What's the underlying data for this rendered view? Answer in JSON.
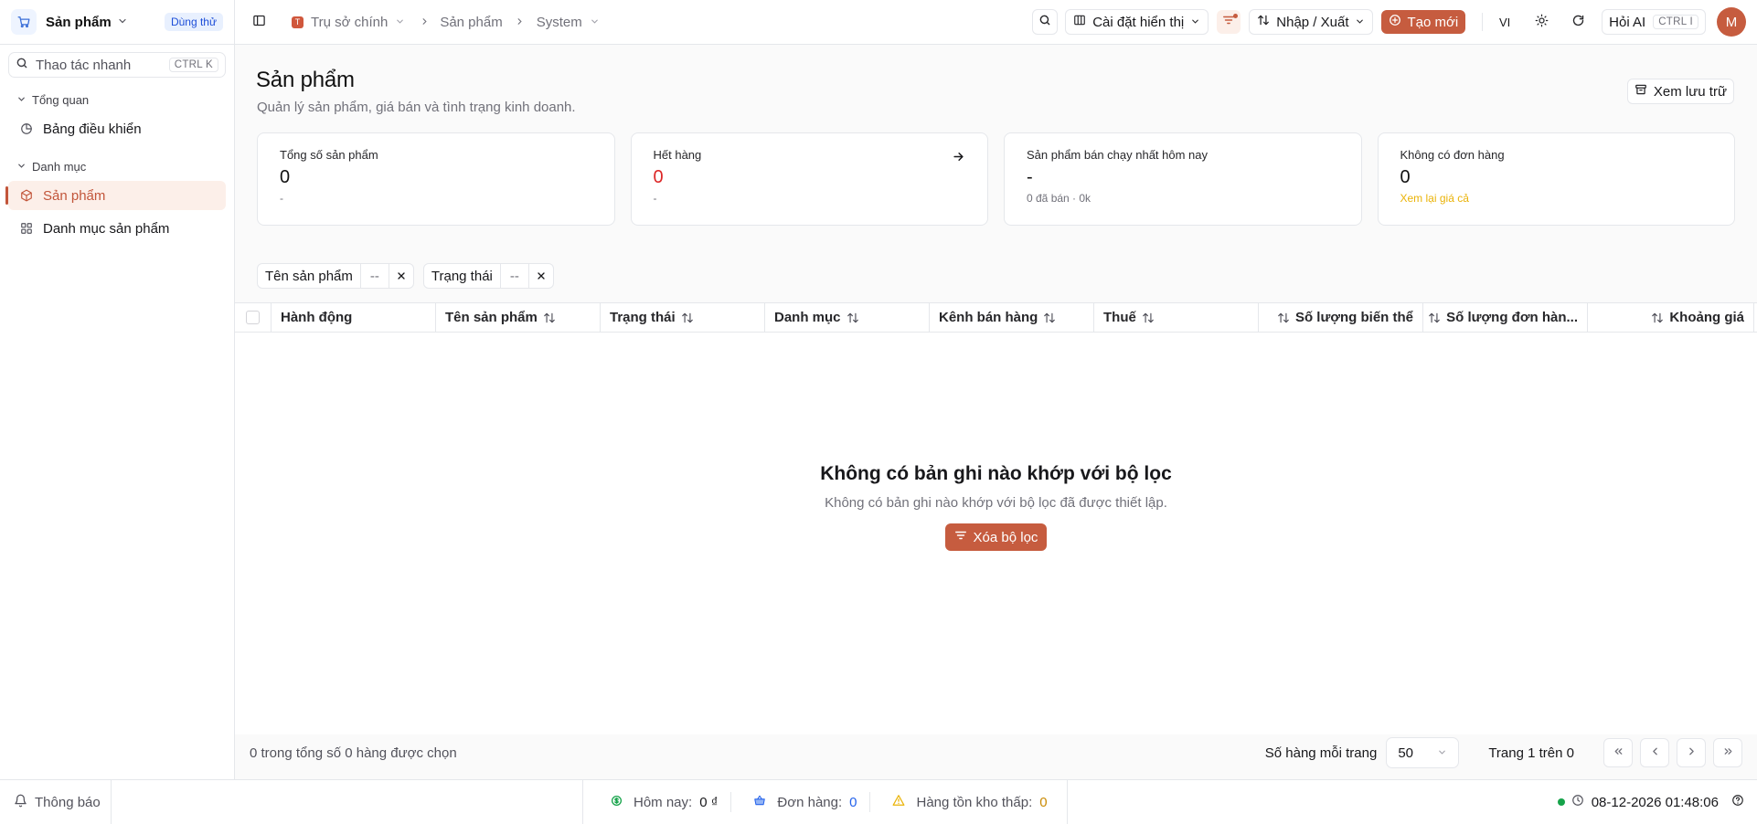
{
  "app": {
    "name": "Sản phẩm",
    "trial_badge": "Dùng thử"
  },
  "quick_search": {
    "placeholder": "Thao tác nhanh",
    "shortcut": "CTRL K"
  },
  "sidebar": {
    "groups": [
      {
        "title": "Tổng quan",
        "items": [
          {
            "label": "Bảng điều khiển",
            "icon": "dashboard-icon"
          }
        ]
      },
      {
        "title": "Danh mục",
        "items": [
          {
            "label": "Sản phẩm",
            "icon": "box-icon",
            "active": true
          },
          {
            "label": "Danh mục sản phẩm",
            "icon": "grid-icon"
          }
        ]
      }
    ]
  },
  "topbar": {
    "breadcrumb": {
      "org_initial": "T",
      "org": "Trụ sở chính",
      "section": "Sản phẩm",
      "view": "System"
    },
    "display_settings": "Cài đặt hiển thị",
    "import_export": "Nhập / Xuất",
    "create_new": "Tạo mới",
    "language": "VI",
    "ask_ai": "Hỏi AI",
    "ask_ai_shortcut": "CTRL I",
    "avatar_initial": "M"
  },
  "page": {
    "title": "Sản phẩm",
    "subtitle": "Quản lý sản phẩm, giá bán và tình trạng kinh doanh.",
    "archive_button": "Xem lưu trữ"
  },
  "cards": [
    {
      "title": "Tổng số sản phẩm",
      "value": "0",
      "foot": "-"
    },
    {
      "title": "Hết hàng",
      "value": "0",
      "foot": "-"
    },
    {
      "title": "Sản phẩm bán chạy nhất hôm nay",
      "value": "-",
      "foot": "0 đã bán · 0k"
    },
    {
      "title": "Không có đơn hàng",
      "value": "0",
      "foot": "Xem lại giá cả"
    }
  ],
  "filters": [
    {
      "label": "Tên sản phẩm",
      "value": "--"
    },
    {
      "label": "Trạng thái",
      "value": "--"
    }
  ],
  "table": {
    "columns": [
      "Hành động",
      "Tên sản phẩm",
      "Trạng thái",
      "Danh mục",
      "Kênh bán hàng",
      "Thuế",
      "Số lượng biến thể",
      "Số lượng đơn hàn...",
      "Khoảng giá"
    ]
  },
  "empty_state": {
    "title": "Không có bản ghi nào khớp với bộ lọc",
    "subtitle": "Không có bản ghi nào khớp với bộ lọc đã được thiết lập.",
    "button": "Xóa bộ lọc"
  },
  "pagination": {
    "selected_text": "0 trong tổng số 0 hàng được chọn",
    "rows_per_page_label": "Số hàng mỗi trang",
    "rows_per_page": "50",
    "page_info": "Trang 1 trên 0"
  },
  "statusbar": {
    "notifications": "Thông báo",
    "today_label": "Hôm nay:",
    "today_value": "0 ₫",
    "orders_label": "Đơn hàng:",
    "orders_value": "0",
    "low_stock_label": "Hàng tồn kho thấp:",
    "low_stock_value": "0",
    "datetime": "08-12-2026 01:48:06"
  },
  "colors": {
    "accent": "#c65c3f",
    "danger": "#dc2626",
    "warning": "#eab308",
    "info": "#2563eb",
    "success": "#16a34a"
  }
}
